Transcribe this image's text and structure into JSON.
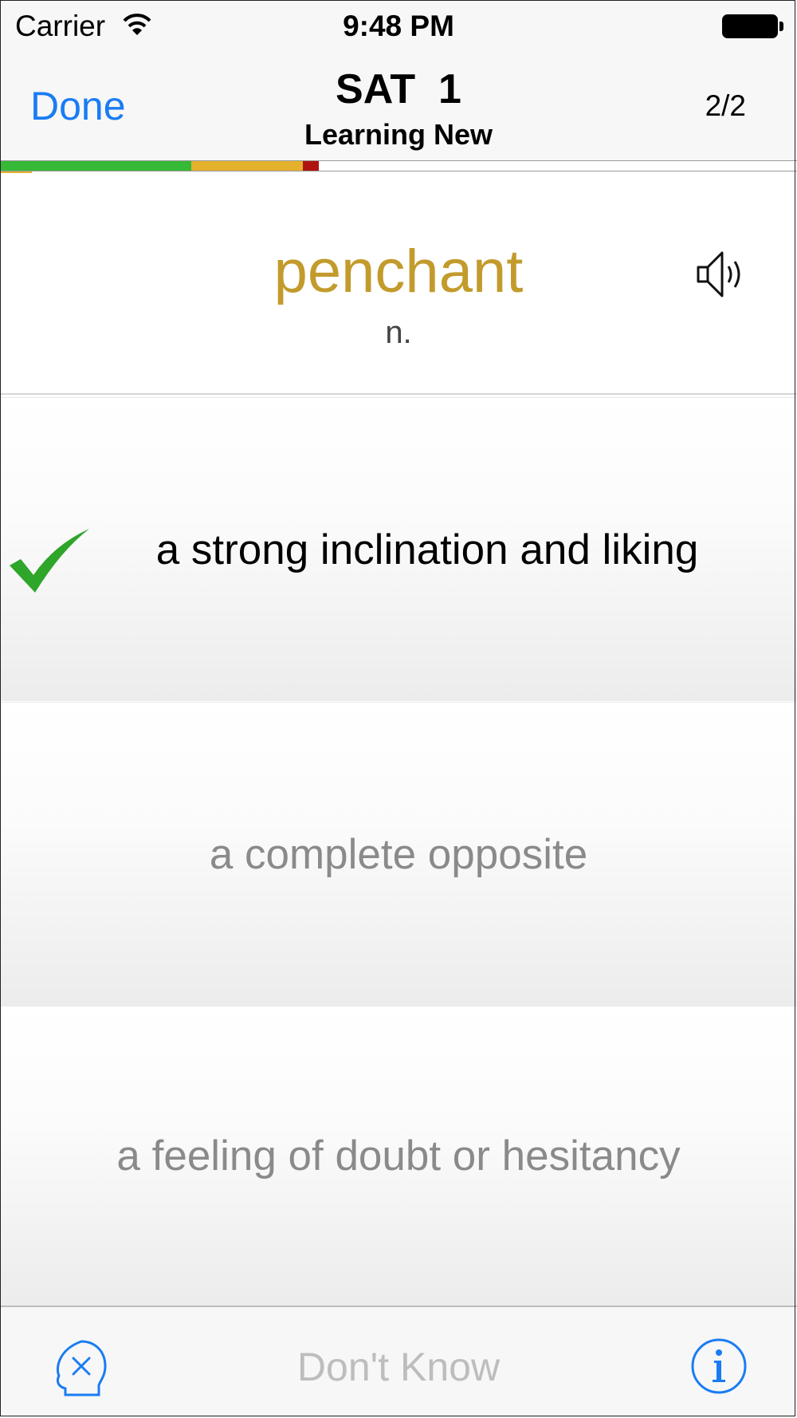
{
  "status_bar": {
    "carrier": "Carrier",
    "time": "9:48 PM"
  },
  "nav": {
    "done_label": "Done",
    "title": "SAT  1",
    "subtitle": "Learning New",
    "counter": "2/2"
  },
  "progress": {
    "segments": [
      {
        "name": "known",
        "fraction": 0.24,
        "color": "#36b936"
      },
      {
        "name": "learning",
        "fraction": 0.14,
        "color": "#e3b12b"
      },
      {
        "name": "missed",
        "fraction": 0.02,
        "color": "#b0130f"
      }
    ]
  },
  "card": {
    "word": "penchant",
    "part_of_speech": "n.",
    "word_color": "#c29b2c"
  },
  "answers": [
    {
      "text": "a strong inclination and liking",
      "state": "correct"
    },
    {
      "text": "a complete opposite",
      "state": "neutral"
    },
    {
      "text": "a feeling of doubt or hesitancy",
      "state": "neutral"
    }
  ],
  "bottom": {
    "dont_know_label": "Don't Know"
  },
  "icons": {
    "wifi": "wifi-icon",
    "battery": "battery-icon",
    "speaker": "speaker-icon",
    "check": "checkmark-icon",
    "skip": "head-x-icon",
    "info": "info-icon"
  },
  "colors": {
    "accent": "#1a7cf3",
    "correct_green": "#2fa52a"
  }
}
